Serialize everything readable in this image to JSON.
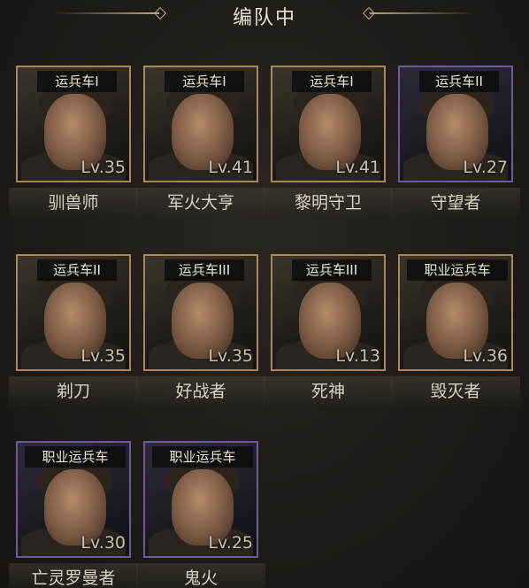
{
  "header": {
    "title": "编队中"
  },
  "cards": [
    {
      "tag": "运兵车I",
      "level": "Lv.35",
      "name": "驯兽师",
      "frame": "gold"
    },
    {
      "tag": "运兵车I",
      "level": "Lv.41",
      "name": "军火大亨",
      "frame": "gold"
    },
    {
      "tag": "运兵车I",
      "level": "Lv.41",
      "name": "黎明守卫",
      "frame": "gold"
    },
    {
      "tag": "运兵车II",
      "level": "Lv.27",
      "name": "守望者",
      "frame": "purple"
    },
    {
      "tag": "运兵车II",
      "level": "Lv.35",
      "name": "剃刀",
      "frame": "gold"
    },
    {
      "tag": "运兵车III",
      "level": "Lv.35",
      "name": "好战者",
      "frame": "gold"
    },
    {
      "tag": "运兵车III",
      "level": "Lv.13",
      "name": "死神",
      "frame": "gold"
    },
    {
      "tag": "职业运兵车",
      "level": "Lv.36",
      "name": "毁灭者",
      "frame": "gold"
    },
    {
      "tag": "职业运兵车",
      "level": "Lv.30",
      "name": "亡灵罗曼者",
      "frame": "purple"
    },
    {
      "tag": "职业运兵车",
      "level": "Lv.25",
      "name": "鬼火",
      "frame": "purple"
    }
  ]
}
